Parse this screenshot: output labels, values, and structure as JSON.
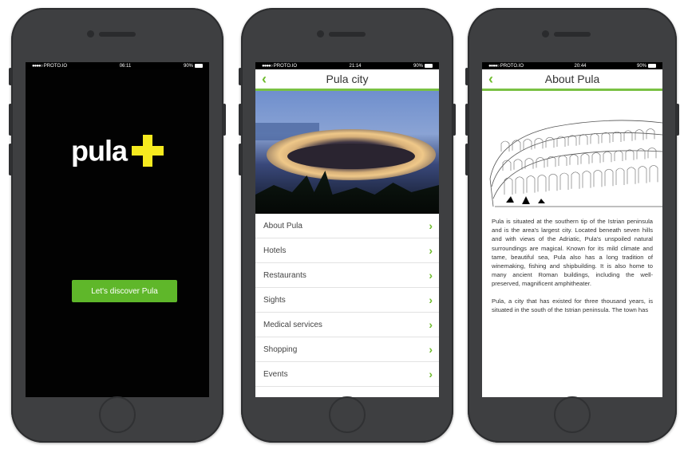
{
  "phones": [
    {
      "status": {
        "signal": "●●●●○",
        "carrier": "PROTO.IO",
        "time": "06:11",
        "battery": "90%"
      },
      "logo_text": "pula",
      "cta_label": "Let's discover Pula"
    },
    {
      "status": {
        "signal": "●●●●○",
        "carrier": "PROTO.IO",
        "time": "21:14",
        "battery": "90%"
      },
      "back_icon": "chevron-left-icon",
      "title": "Pula city",
      "menu": [
        {
          "label": "About Pula"
        },
        {
          "label": "Hotels"
        },
        {
          "label": "Restaurants"
        },
        {
          "label": "Sights"
        },
        {
          "label": "Medical services"
        },
        {
          "label": "Shopping"
        },
        {
          "label": "Events"
        }
      ]
    },
    {
      "status": {
        "signal": "●●●●○",
        "carrier": "PROTO.IO",
        "time": "20:44",
        "battery": "90%"
      },
      "back_icon": "chevron-left-icon",
      "title": "About Pula",
      "paragraphs": [
        "Pula is situated at the southern tip of the Istrian peninsula and is the area's largest city. Located beneath seven hills and with views of the Adriatic, Pula's unspoiled natural surroundings are magical. Known for its mild climate and tame, beautiful sea, Pula also has a long tradition of winemaking, fishing and shipbuilding. It is also home to many ancient Roman buildings, including the well-preserved, magnificent amphitheater.",
        "Pula, a city that has existed for three thousand years, is situated in the south of the Istrian peninsula. The town has"
      ]
    }
  ],
  "colors": {
    "accent": "#6dbb2b",
    "logo_plus": "#f6ea1f",
    "phone_body": "#3e3f41"
  }
}
